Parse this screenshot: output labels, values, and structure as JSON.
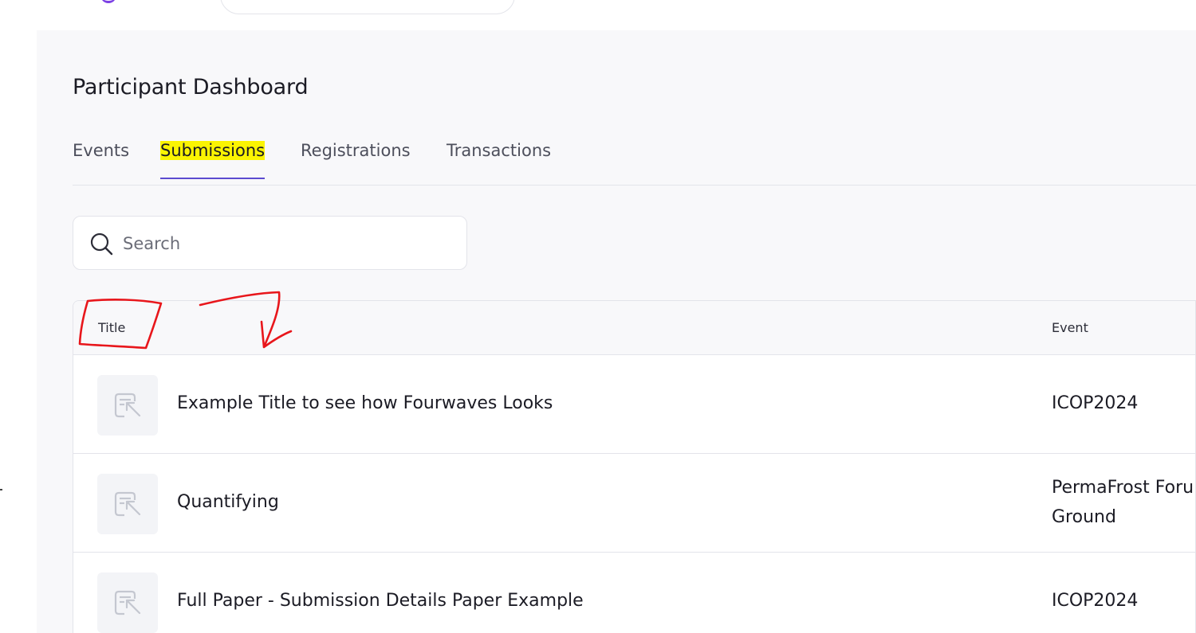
{
  "header": {
    "icons": {
      "logo": "logo-icon"
    }
  },
  "page": {
    "title": "Participant Dashboard"
  },
  "tabs": [
    {
      "label": "Events",
      "active": false
    },
    {
      "label": "Submissions",
      "active": true
    },
    {
      "label": "Registrations",
      "active": false
    },
    {
      "label": "Transactions",
      "active": false
    }
  ],
  "search": {
    "placeholder": "Search",
    "value": "",
    "icon": "search-icon"
  },
  "table": {
    "columns": [
      "Title",
      "Event"
    ],
    "rows": [
      {
        "title": "Example Title to see how Fourwaves Looks",
        "event": "ICOP2024",
        "icon": "document-icon"
      },
      {
        "title": "Quantifying",
        "event": "PermaFrost Foru\nGround",
        "icon": "document-icon"
      },
      {
        "title": "Full Paper - Submission Details Paper Example",
        "event": "ICOP2024",
        "icon": "document-icon"
      }
    ]
  },
  "colors": {
    "accent": "#5b4bd0",
    "highlight": "#fbf402",
    "annotation": "#e8161b",
    "logo": "#7b3fe4"
  }
}
